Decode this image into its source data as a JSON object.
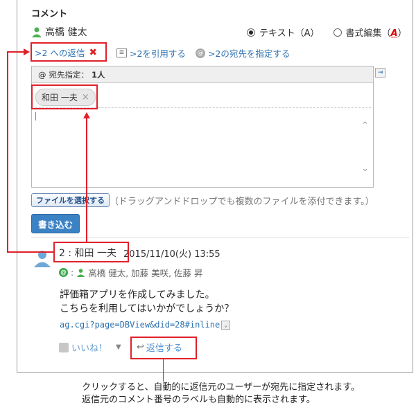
{
  "section_title": "コメント",
  "author": {
    "name": "高橋 健太"
  },
  "format_options": {
    "text_label": "テキスト（A）",
    "rich_label": "書式編集（",
    "rich_icon_letter": "A",
    "rich_close": "）"
  },
  "reply": {
    "label": ">2 への返信",
    "quote_label": ">2を引用する",
    "address_label": ">2の宛先を指定する"
  },
  "editor": {
    "recipients_label": "宛先指定：",
    "recipients_count": "1人",
    "chip_name": "和田 一夫"
  },
  "file": {
    "button_label": "ファイルを選択する",
    "hint": "（ドラッグアンドドロップでも複数のファイルを添付できます。）"
  },
  "submit_label": "書き込む",
  "comment": {
    "number": "2",
    "author": "和田 一夫",
    "datetime": "2015/11/10(火) 13:55",
    "recipients": "高橋 健太, 加藤 美咲, 佐藤 昇",
    "line1": "評価箱アプリを作成してみました。",
    "line2": "こちらを利用してはいかがでしょうか？",
    "link": "ag.cgi?page=DBView&did=28#inline",
    "like_label": "いいね！",
    "reply_label": "返信する"
  },
  "annotation": {
    "line1": "クリックすると、自動的に返信元のユーザーが宛先に指定されます。",
    "line2": "返信元のコメント番号のラベルも自動的に表示されます。"
  },
  "colors": {
    "accent": "#2a6fb0",
    "highlight": "#e0202a",
    "submit": "#3b82c4"
  }
}
